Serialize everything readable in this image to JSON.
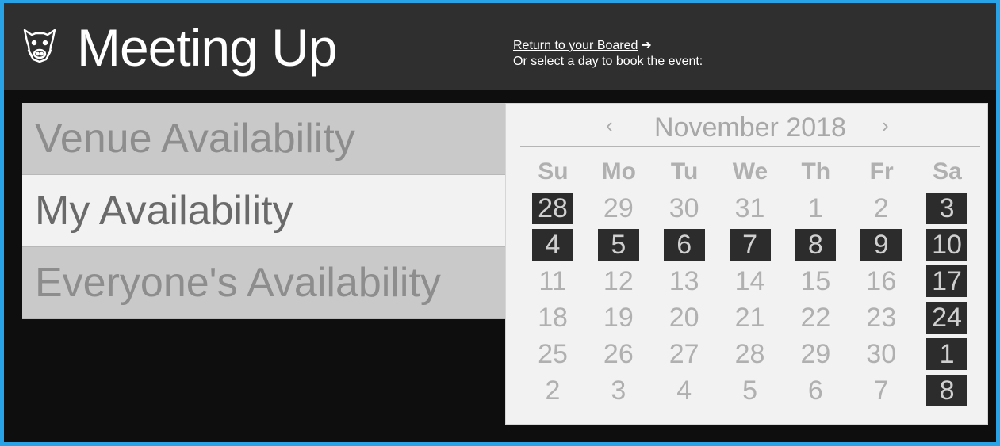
{
  "header": {
    "title": "Meeting Up",
    "return_link": "Return to your Boared",
    "subtitle": "Or select a day to book the event:"
  },
  "tabs": [
    {
      "label": "Venue Availability",
      "active": false
    },
    {
      "label": "My Availability",
      "active": true
    },
    {
      "label": "Everyone's Availability",
      "active": false
    }
  ],
  "calendar": {
    "month_label": "November 2018",
    "prev_label": "‹",
    "next_label": "›",
    "weekdays": [
      "Su",
      "Mo",
      "Tu",
      "We",
      "Th",
      "Fr",
      "Sa"
    ],
    "weeks": [
      [
        {
          "d": "28",
          "booked": true
        },
        {
          "d": "29",
          "booked": false
        },
        {
          "d": "30",
          "booked": false
        },
        {
          "d": "31",
          "booked": false
        },
        {
          "d": "1",
          "booked": false
        },
        {
          "d": "2",
          "booked": false
        },
        {
          "d": "3",
          "booked": true
        }
      ],
      [
        {
          "d": "4",
          "booked": true
        },
        {
          "d": "5",
          "booked": true
        },
        {
          "d": "6",
          "booked": true
        },
        {
          "d": "7",
          "booked": true
        },
        {
          "d": "8",
          "booked": true
        },
        {
          "d": "9",
          "booked": true
        },
        {
          "d": "10",
          "booked": true
        }
      ],
      [
        {
          "d": "11",
          "booked": false
        },
        {
          "d": "12",
          "booked": false
        },
        {
          "d": "13",
          "booked": false
        },
        {
          "d": "14",
          "booked": false
        },
        {
          "d": "15",
          "booked": false
        },
        {
          "d": "16",
          "booked": false
        },
        {
          "d": "17",
          "booked": true
        }
      ],
      [
        {
          "d": "18",
          "booked": false
        },
        {
          "d": "19",
          "booked": false
        },
        {
          "d": "20",
          "booked": false
        },
        {
          "d": "21",
          "booked": false
        },
        {
          "d": "22",
          "booked": false
        },
        {
          "d": "23",
          "booked": false
        },
        {
          "d": "24",
          "booked": true
        }
      ],
      [
        {
          "d": "25",
          "booked": false
        },
        {
          "d": "26",
          "booked": false
        },
        {
          "d": "27",
          "booked": false
        },
        {
          "d": "28",
          "booked": false
        },
        {
          "d": "29",
          "booked": false
        },
        {
          "d": "30",
          "booked": false
        },
        {
          "d": "1",
          "booked": true
        }
      ],
      [
        {
          "d": "2",
          "booked": false
        },
        {
          "d": "3",
          "booked": false
        },
        {
          "d": "4",
          "booked": false
        },
        {
          "d": "5",
          "booked": false
        },
        {
          "d": "6",
          "booked": false
        },
        {
          "d": "7",
          "booked": false
        },
        {
          "d": "8",
          "booked": true
        }
      ]
    ]
  },
  "icons": {
    "logo": "boar-head-icon",
    "return_arrow": "arrow-right-icon"
  },
  "colors": {
    "border": "#29a3e6",
    "header_bg": "#2f2f2f",
    "booked_bg": "#2c2c2c",
    "active_tab": "#f2f2f2",
    "inactive_tab": "#c9c9c9"
  }
}
